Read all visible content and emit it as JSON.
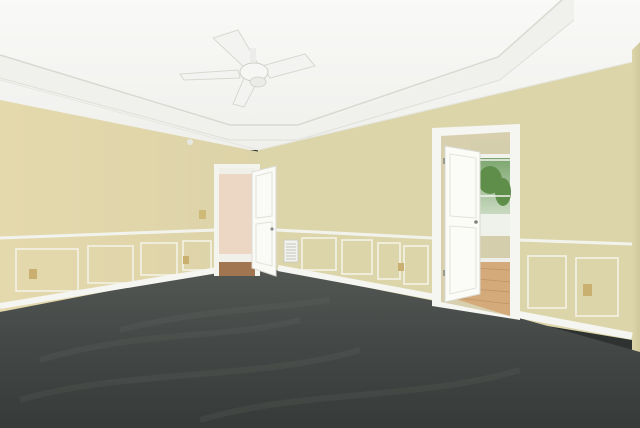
{
  "scene": {
    "colors": {
      "wall_left": "#e2d8ad",
      "wall_back": "#ddd6ac",
      "wall_right": "#d9d2a6",
      "ceiling": "#f7f7f4",
      "tray": "#f1f1ec",
      "trim": "#f4f4f0",
      "carpet": "#3f4341",
      "carpet_far": "#4e524f",
      "hall_wall": "#ead3c3",
      "hall_floor": "#a07550",
      "room_floor": "#d2a878",
      "window_green": "#5f8d4a",
      "outlet": "#c9b070",
      "fan_blade": "#f3f3f1"
    },
    "icons": [
      "ceiling-fan-icon",
      "hvac-vent-icon",
      "outlet-icon",
      "light-switch-icon"
    ]
  }
}
